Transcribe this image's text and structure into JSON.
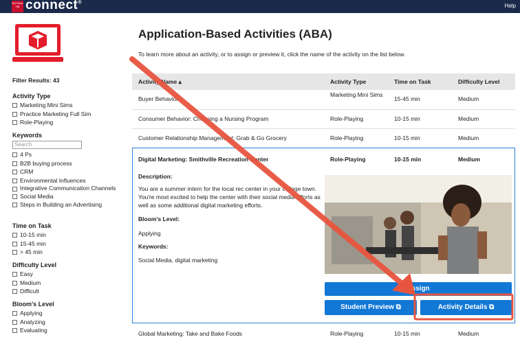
{
  "topbar": {
    "brand_small": "Mc Graw Hill",
    "brand": "connect",
    "registered": "®",
    "help": "Help"
  },
  "sidebar": {
    "filter_results": "Filter Results: 43",
    "activity_type": {
      "heading": "Activity Type",
      "options": [
        "Marketing Mini Sims",
        "Practice Marketing Full Sim",
        "Role-Playing"
      ]
    },
    "keywords": {
      "heading": "Keywords",
      "search_placeholder": "Search",
      "options": [
        "4 Ps",
        "B2B buying process",
        "CRM",
        "Environmental Influences",
        "Integrative Communication Channels",
        "Social Media",
        "Steps in Building an Advertising"
      ]
    },
    "time_on_task": {
      "heading": "Time on Task",
      "options": [
        "10-15 min",
        "15-45 min",
        "> 45 min"
      ]
    },
    "difficulty": {
      "heading": "Difficulty Level",
      "options": [
        "Easy",
        "Medium",
        "Difficult"
      ]
    },
    "blooms": {
      "heading": "Bloom's Level",
      "options": [
        "Applying",
        "Analyzing",
        "Evaluating"
      ]
    }
  },
  "main": {
    "title": "Application-Based Activities (ABA)",
    "intro": "To learn more about an activity, or to assign or preview it, click the name of the activity on the list below.",
    "columns": [
      "Activity Name ▴",
      "Activity Type",
      "Time on Task",
      "Difficulty Level"
    ],
    "rows": [
      {
        "name": "Buyer Behavior",
        "type": "Marketing Mini Sims",
        "time": "15-45 min",
        "difficulty": "Medium"
      },
      {
        "name": "Consumer Behavior: Choosing a Nursing Program",
        "type": "Role-Playing",
        "time": "10-15 min",
        "difficulty": "Medium"
      },
      {
        "name": "Customer Relationship Management: Grab & Go Grocery",
        "type": "Role-Playing",
        "time": "10-15 min",
        "difficulty": "Medium"
      }
    ],
    "expanded": {
      "name": "Digital Marketing: Smithville Recreation Center",
      "type": "Role-Playing",
      "time": "10-15 min",
      "difficulty": "Medium",
      "description_label": "Description:",
      "description": "You are a summer intern for the local rec center in your college town. You're most excited to help the center with their social media efforts as well as some additional digital marketing efforts.",
      "blooms_label": "Bloom's Level:",
      "blooms": "Applying",
      "keywords_label": "Keywords:",
      "keywords": "Social Media, digital marketing",
      "assign_label": "Assign",
      "preview_label": "Student Preview",
      "details_label": "Activity Details",
      "external_glyph": "⧉"
    },
    "last_row": {
      "name": "Global Marketing: Take and Bake Foods",
      "type": "Role-Playing",
      "time": "10-15 min",
      "difficulty": "Medium"
    }
  },
  "colors": {
    "topbar": "#1b2a4a",
    "brand_red": "#c8102e",
    "button_blue": "#1278d6",
    "annotation_red": "#e8553f"
  }
}
